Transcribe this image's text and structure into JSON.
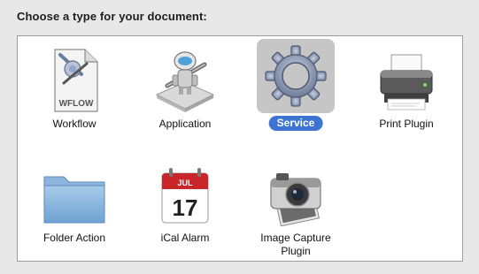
{
  "heading": "Choose a type for your document:",
  "items": [
    {
      "label": "Workflow",
      "icon": "workflow-document-icon",
      "icon_text": "WFLOW",
      "selected": false
    },
    {
      "label": "Application",
      "icon": "automator-robot-icon",
      "selected": false
    },
    {
      "label": "Service",
      "icon": "gear-icon",
      "selected": true
    },
    {
      "label": "Print Plugin",
      "icon": "printer-icon",
      "selected": false
    },
    {
      "label": "Folder Action",
      "icon": "folder-icon",
      "selected": false
    },
    {
      "label": "iCal Alarm",
      "icon": "calendar-icon",
      "icon_month": "JUL",
      "icon_day": "17",
      "selected": false
    },
    {
      "label": "Image Capture Plugin",
      "icon": "camera-icon",
      "selected": false
    }
  ],
  "colors": {
    "selection_highlight": "#3d74d1",
    "selected_tile": "#c6c6c6",
    "window_bg": "#e8e8e8"
  }
}
